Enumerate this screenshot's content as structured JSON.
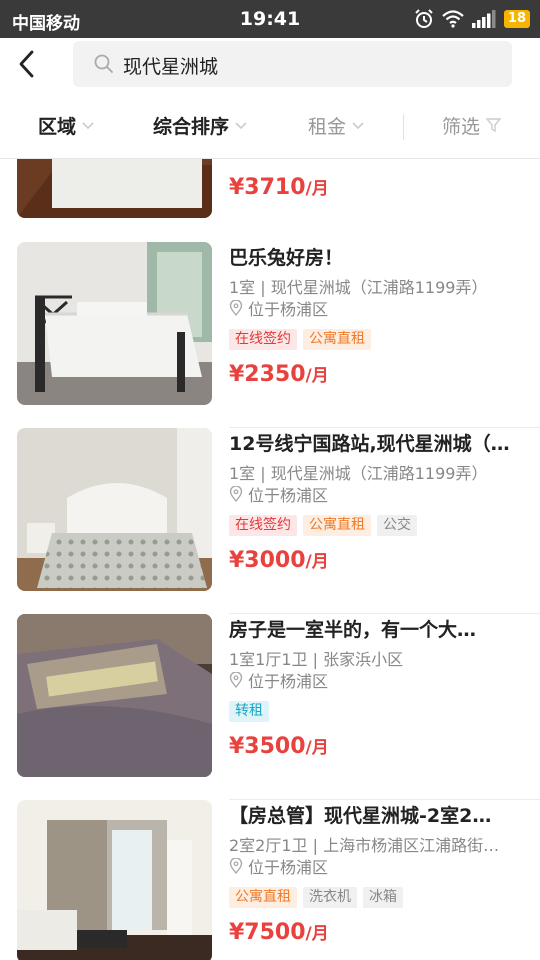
{
  "status_bar": {
    "carrier": "中国移动",
    "time": "19:41",
    "battery": "18"
  },
  "search": {
    "query": "现代星洲城"
  },
  "filters": [
    {
      "label": "区域"
    },
    {
      "label": "综合排序"
    },
    {
      "label": "租金"
    },
    {
      "label": "筛选"
    }
  ],
  "listings": [
    {
      "title": "",
      "info": "",
      "location": "",
      "tags": [],
      "price": "¥3710",
      "unit": "/月"
    },
    {
      "title": "巴乐兔好房！",
      "info": "1室 | 现代星洲城（江浦路1199弄）",
      "location": "位于杨浦区",
      "tags": [
        {
          "text": "在线签约",
          "style": "red"
        },
        {
          "text": "公寓直租",
          "style": "orange"
        }
      ],
      "price": "¥2350",
      "unit": "/月"
    },
    {
      "title": "12号线宁国路站,现代星洲城（…",
      "info": "1室 | 现代星洲城（江浦路1199弄）",
      "location": "位于杨浦区",
      "tags": [
        {
          "text": "在线签约",
          "style": "red"
        },
        {
          "text": "公寓直租",
          "style": "orange"
        },
        {
          "text": "公交",
          "style": "gray"
        }
      ],
      "price": "¥3000",
      "unit": "/月"
    },
    {
      "title": "房子是一室半的，有一个大…",
      "info": "1室1厅1卫 | 张家浜小区",
      "location": "位于杨浦区",
      "tags": [
        {
          "text": "转租",
          "style": "cyan"
        }
      ],
      "price": "¥3500",
      "unit": "/月"
    },
    {
      "title": "【房总管】现代星洲城-2室2…",
      "info": "2室2厅1卫 | 上海市杨浦区江浦路街…",
      "location": "位于杨浦区",
      "tags": [
        {
          "text": "公寓直租",
          "style": "orange"
        },
        {
          "text": "洗衣机",
          "style": "gray"
        },
        {
          "text": "冰箱",
          "style": "gray"
        }
      ],
      "price": "¥7500",
      "unit": "/月"
    }
  ],
  "colors": {
    "price": "#e8413e",
    "status_bar": "#3a3a3a",
    "battery": "#f6b500"
  }
}
